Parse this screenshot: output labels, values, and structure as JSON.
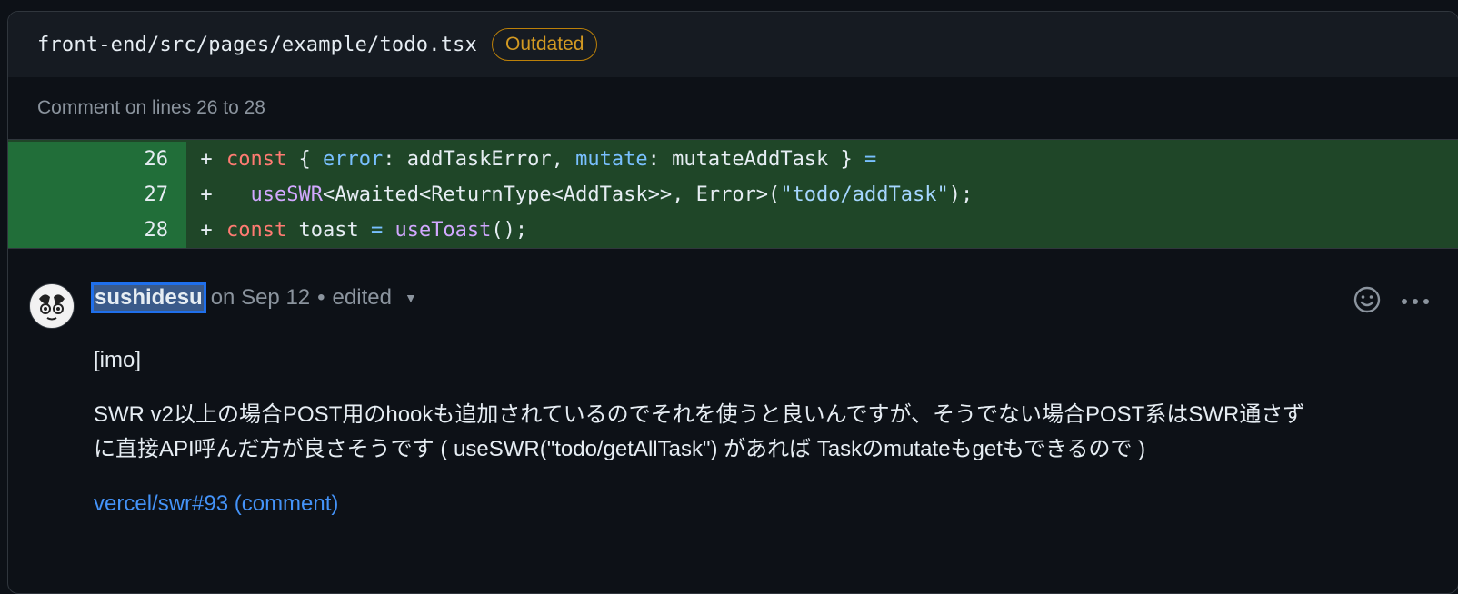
{
  "file": {
    "path": "front-end/src/pages/example/todo.tsx",
    "badge": "Outdated"
  },
  "comment_range": "Comment on lines 26 to 28",
  "diff": {
    "lines": [
      {
        "number": "26",
        "sign": "+"
      },
      {
        "number": "27",
        "sign": "+"
      },
      {
        "number": "28",
        "sign": "+"
      }
    ],
    "code": {
      "l26": {
        "t1": "const",
        "t2": " { ",
        "t3": "error",
        "t4": ": addTaskError, ",
        "t5": "mutate",
        "t6": ": mutateAddTask } ",
        "t7": "="
      },
      "l27": {
        "t1": "  ",
        "t2": "useSWR",
        "t3": "<Awaited<ReturnType<AddTask>>, Error>(",
        "t4": "\"todo/addTask\"",
        "t5": ");"
      },
      "l28": {
        "t1": "const",
        "t2": " toast ",
        "t3": "=",
        "t4": " ",
        "t5": "useToast",
        "t6": "();"
      }
    }
  },
  "comment": {
    "author": "sushidesu",
    "date": "on Sep 12",
    "separator": "•",
    "edited": "edited",
    "body": {
      "tag": "[imo]",
      "line1": "SWR v2以上の場合POST用のhookも追加されているのでそれを使うと良いんですが、そうでない場合POST系はSWR通さず",
      "line2": "に直接API呼んだ方が良さそうです ( useSWR(\"todo/getAllTask\") があれば Taskのmutateもgetもできるので )",
      "link": "vercel/swr#93 (comment)"
    }
  },
  "icons": {
    "emoji": "smiley-icon",
    "more": "kebab-horizontal-icon",
    "caret": "triangle-down-icon"
  },
  "colors": {
    "background": "#0d1117",
    "added_line": "#1f4628",
    "added_number": "#216e39",
    "accent": "#4493f8",
    "badge": "#d29922"
  }
}
